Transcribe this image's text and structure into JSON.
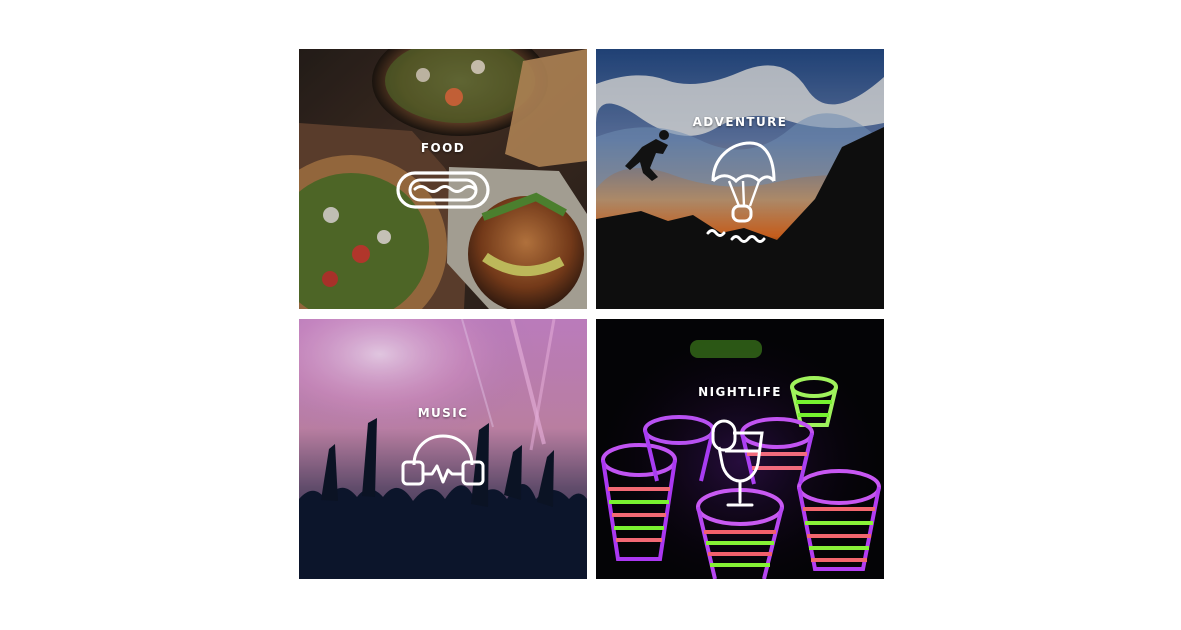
{
  "grid": {
    "tiles": [
      {
        "label": "FOOD",
        "icon": "hotdog-icon"
      },
      {
        "label": "ADVENTURE",
        "icon": "parachute-icon"
      },
      {
        "label": "MUSIC",
        "icon": "headphones-icon"
      },
      {
        "label": "NIGHTLIFE",
        "icon": "cocktail-icon"
      }
    ]
  },
  "colors": {
    "page_background": "#ffffff",
    "label_text": "#ffffff"
  }
}
